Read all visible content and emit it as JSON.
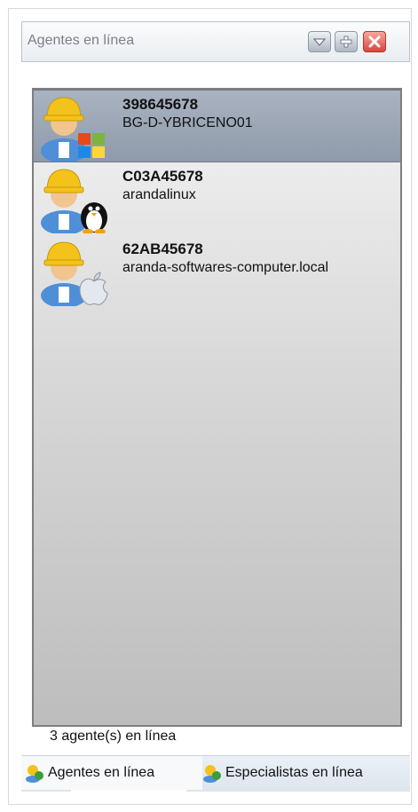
{
  "window": {
    "title": "Agentes en línea",
    "buttons": [
      "minimize",
      "maximize",
      "close"
    ]
  },
  "agents": [
    {
      "id": "398645678",
      "name": "BG-D-YBRICENO01",
      "os_icon": "windows-logo-icon",
      "selected": true
    },
    {
      "id": "C03A45678",
      "name": "arandalinux",
      "os_icon": "linux-penguin-icon",
      "selected": false
    },
    {
      "id": "62AB45678",
      "name": "aranda-softwares-computer.local",
      "os_icon": "apple-logo-icon",
      "selected": false
    }
  ],
  "status": {
    "text": "3 agente(s) en línea"
  },
  "tabs": [
    {
      "label": "Agentes en línea",
      "active": true
    },
    {
      "label": "Especialistas en línea",
      "active": false
    }
  ],
  "colors": {
    "selected_row": "#9aa4b3",
    "close_button": "#d8473b",
    "title_text": "#7a7f87"
  }
}
